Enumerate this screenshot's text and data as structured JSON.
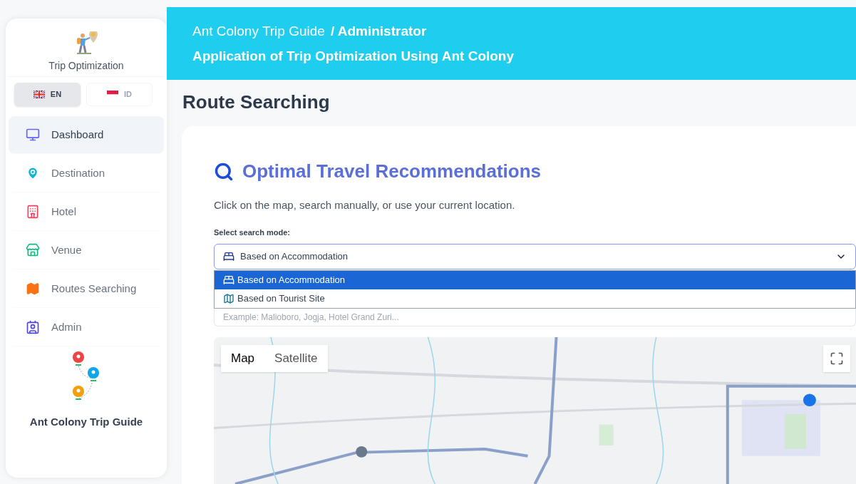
{
  "header": {
    "breadcrumb": "Ant Colony Trip Guide",
    "role": "/ Administrator",
    "subtitle": "Application of Trip Optimization Using Ant Colony"
  },
  "sidebar": {
    "brand": "Trip Optimization",
    "languages": [
      {
        "code": "EN",
        "selected": true
      },
      {
        "code": "ID",
        "selected": false
      }
    ],
    "items": [
      {
        "label": "Dashboard",
        "selected": true
      },
      {
        "label": "Destination",
        "selected": false
      },
      {
        "label": "Hotel",
        "selected": false
      },
      {
        "label": "Venue",
        "selected": false
      },
      {
        "label": "Routes Searching",
        "selected": false
      },
      {
        "label": "Admin",
        "selected": false
      }
    ],
    "footer": "Ant Colony Trip Guide"
  },
  "page_title": "Route Searching",
  "card": {
    "title": "Optimal Travel Recommendations",
    "description": "Click on the map, search manually, or use your current location.",
    "mode_label": "Select search mode:",
    "select": {
      "value": "Based on Accommodation",
      "expanded": true,
      "options": [
        {
          "label": "Based on Accommodation",
          "selected": true
        },
        {
          "label": "Based on Tourist Site",
          "selected": false
        }
      ]
    },
    "search": {
      "placeholder": "Example: Malioboro, Jogja, Hotel Grand Zuri..."
    },
    "map": {
      "types": [
        {
          "label": "Map",
          "selected": true
        },
        {
          "label": "Satellite",
          "selected": false
        }
      ]
    }
  }
}
